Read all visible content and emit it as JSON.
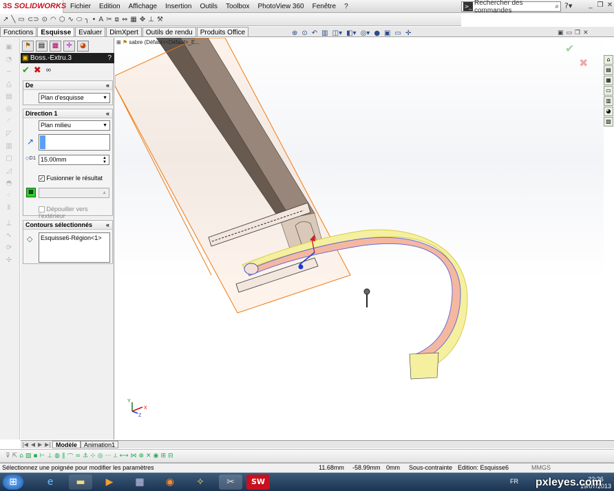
{
  "app": {
    "brand": "SOLIDWORKS",
    "brand_mark": "3S"
  },
  "menu": [
    "Fichier",
    "Edition",
    "Affichage",
    "Insertion",
    "Outils",
    "Toolbox",
    "PhotoView 360",
    "Fenêtre",
    "?"
  ],
  "search": {
    "placeholder": "Rechercher des commandes"
  },
  "tabs": [
    {
      "label": "Fonctions",
      "active": false
    },
    {
      "label": "Esquisse",
      "active": true
    },
    {
      "label": "Evaluer",
      "active": false
    },
    {
      "label": "DimXpert",
      "active": false
    },
    {
      "label": "Outils de rendu",
      "active": false
    },
    {
      "label": "Produits Office",
      "active": false
    }
  ],
  "feature": {
    "title": "Boss.-Extru.3",
    "help": "?",
    "group_from": {
      "header": "De",
      "value": "Plan d'esquisse"
    },
    "group_dir1": {
      "header": "Direction 1",
      "end_condition": "Plan milieu",
      "depth": "15.00mm",
      "depth_prefix": "D1",
      "merge_label": "Fusionner le résultat",
      "merge_checked": true,
      "draft_label": "Dépouiller vers l'extérieur",
      "draft_checked": false
    },
    "group_contours": {
      "header": "Contours sélectionnés",
      "item": "Esquisse6-Région<1>"
    }
  },
  "tree": {
    "label": "sabre  (Défaut<<Défaut>_E..."
  },
  "bottom_tabs": [
    {
      "label": "Modèle",
      "active": true
    },
    {
      "label": "Animation1",
      "active": false
    }
  ],
  "status": {
    "hint": "Sélectionnez une poignée pour modifier les paramètres",
    "x": "11.68mm",
    "y": "-58.99mm",
    "z": "0mm",
    "state": "Sous-contrainte",
    "edition": "Edition: Esquisse6",
    "units": "MMGS"
  },
  "taskbar": {
    "lang": "FR",
    "time": "22:26",
    "date": "19/07/2013"
  },
  "watermark": "pxleyes.com",
  "triad": {
    "x": "X",
    "y": "Y",
    "z": "Z"
  },
  "colors": {
    "accent": "#c8101f",
    "preview_orange": "#f07a10",
    "sweep_yellow": "#f5f0a0"
  }
}
